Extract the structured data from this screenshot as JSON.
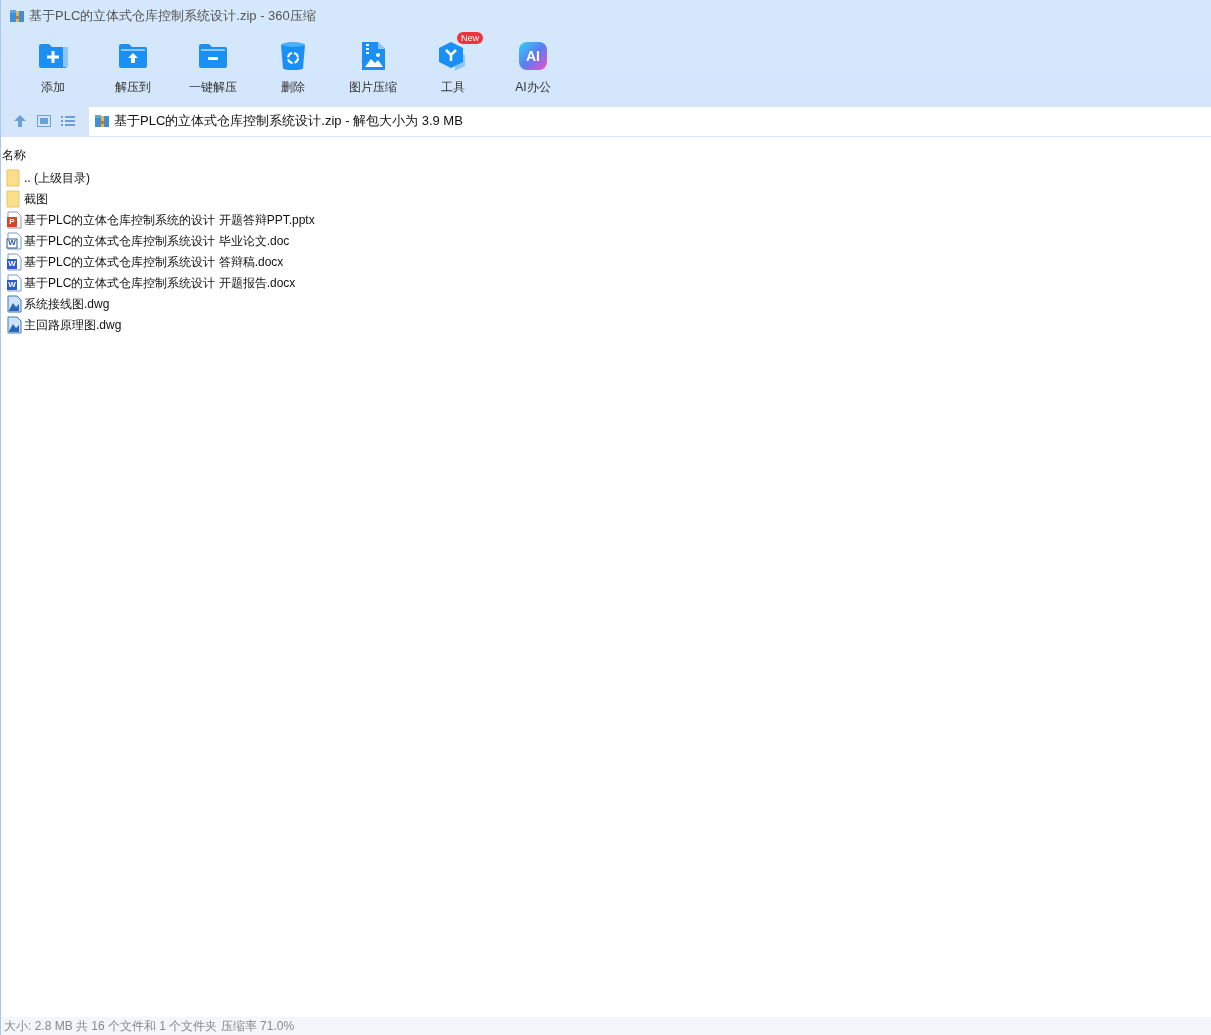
{
  "window": {
    "title": "基于PLC的立体式仓库控制系统设计.zip - 360压缩"
  },
  "toolbar": [
    {
      "kind": "add",
      "label": "添加"
    },
    {
      "kind": "extract",
      "label": "解压到"
    },
    {
      "kind": "quick",
      "label": "一键解压"
    },
    {
      "kind": "delete",
      "label": "删除"
    },
    {
      "kind": "image",
      "label": "图片压缩"
    },
    {
      "kind": "tools",
      "label": "工具",
      "badge": "New"
    },
    {
      "kind": "ai",
      "label": "AI办公",
      "glyph": "AI"
    }
  ],
  "address_bar": {
    "path": "基于PLC的立体式仓库控制系统设计.zip - 解包大小为 3.9 MB"
  },
  "file_list": {
    "columns": [
      "名称"
    ],
    "rows": [
      {
        "kind": "folder",
        "name": ".. (上级目录)"
      },
      {
        "kind": "folder",
        "name": "截图"
      },
      {
        "kind": "pptx",
        "name": "基于PLC的立体仓库控制系统的设计 开题答辩PPT.pptx",
        "glyph": "P"
      },
      {
        "kind": "doc",
        "name": "基于PLC的立体式仓库控制系统设计 毕业论文.doc",
        "glyph": "W"
      },
      {
        "kind": "docx",
        "name": "基于PLC的立体式仓库控制系统设计 答辩稿.docx",
        "glyph": "W"
      },
      {
        "kind": "docx",
        "name": "基于PLC的立体式仓库控制系统设计 开题报告.docx",
        "glyph": "W"
      },
      {
        "kind": "dwg",
        "name": "系统接线图.dwg"
      },
      {
        "kind": "dwg",
        "name": "主回路原理图.dwg"
      }
    ]
  },
  "status_bar": {
    "text": "大小: 2.8 MB 共 16 个文件和 1 个文件夹 压缩率 71.0%"
  }
}
